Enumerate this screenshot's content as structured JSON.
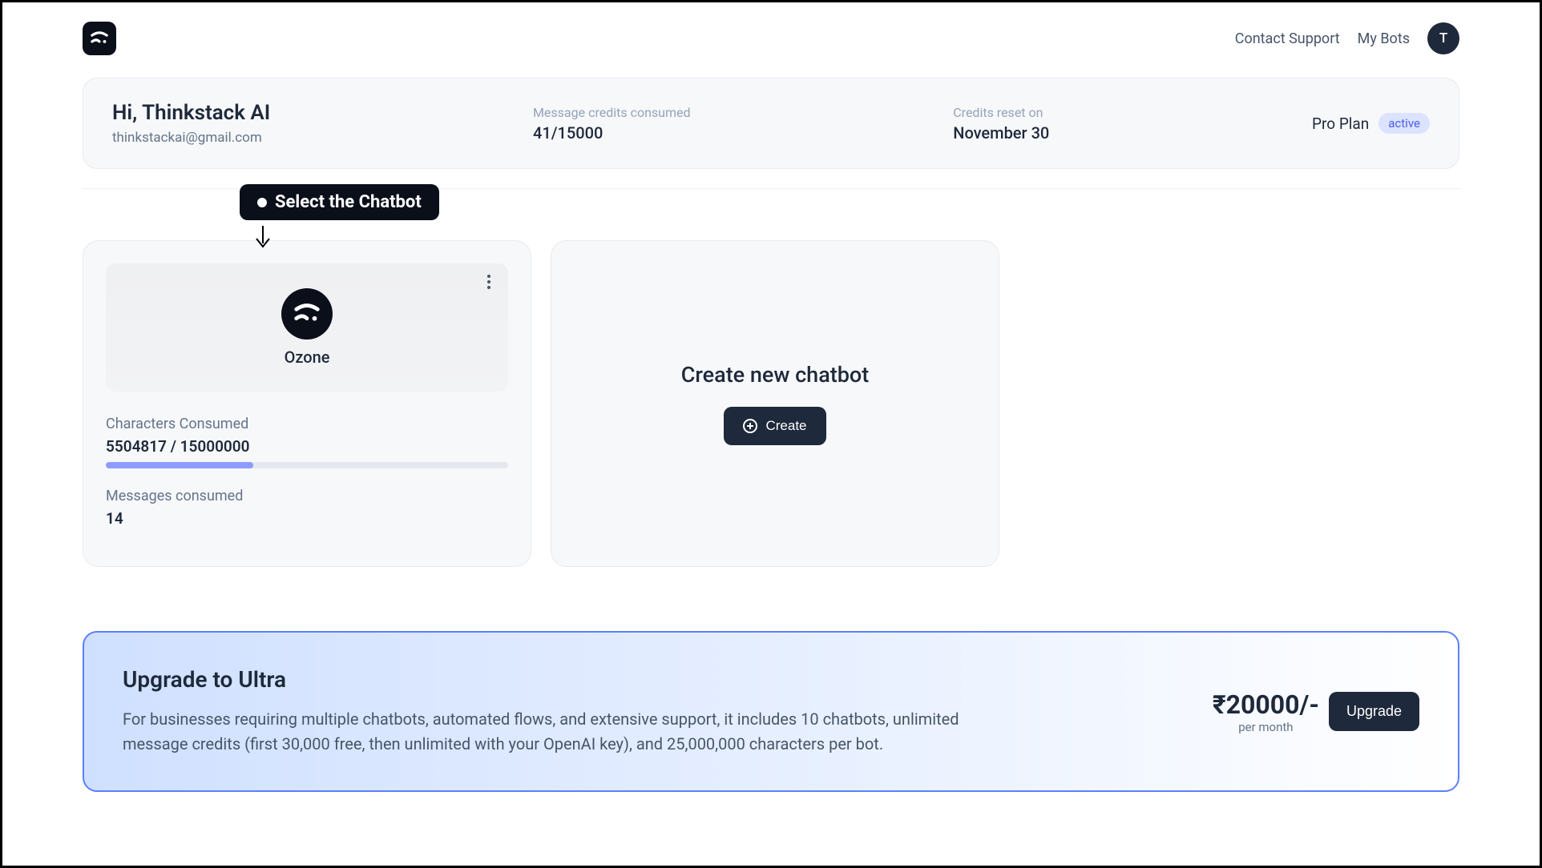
{
  "nav": {
    "contact": "Contact Support",
    "mybots": "My Bots",
    "avatar_initial": "T"
  },
  "header": {
    "greeting": "Hi, Thinkstack AI",
    "email": "thinkstackai@gmail.com",
    "credits_label": "Message credits consumed",
    "credits_value": "41/15000",
    "reset_label": "Credits reset on",
    "reset_value": "November 30",
    "plan_name": "Pro Plan",
    "plan_badge": "active"
  },
  "tooltip": {
    "text": "Select the Chatbot"
  },
  "bot": {
    "name": "Ozone",
    "char_label": "Characters Consumed",
    "char_consumed": 5504817,
    "char_limit": 15000000,
    "char_display": "5504817 / 15000000",
    "progress_percent": 36.7,
    "msg_label": "Messages consumed",
    "msg_count": "14"
  },
  "create": {
    "title": "Create new chatbot",
    "button": "Create"
  },
  "upgrade": {
    "title": "Upgrade to Ultra",
    "desc": "For businesses requiring multiple chatbots, automated flows, and extensive support, it includes 10 chatbots, unlimited message credits (first 30,000 free, then unlimited with your OpenAI key), and 25,000,000 characters per bot.",
    "price": "₹20000/-",
    "period": "per month",
    "button": "Upgrade"
  }
}
